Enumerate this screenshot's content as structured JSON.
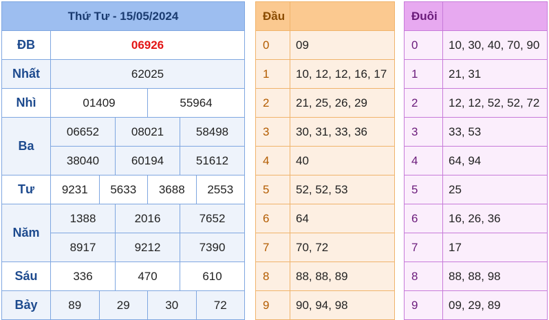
{
  "results": {
    "title": "Thứ Tư - 15/05/2024",
    "db": {
      "label": "ĐB",
      "values": [
        "06926"
      ]
    },
    "nhat": {
      "label": "Nhất",
      "values": [
        "62025"
      ]
    },
    "nhi": {
      "label": "Nhì",
      "values": [
        "01409",
        "55964"
      ]
    },
    "ba": {
      "label": "Ba",
      "values": [
        "06652",
        "08021",
        "58498",
        "38040",
        "60194",
        "51612"
      ]
    },
    "tu": {
      "label": "Tư",
      "values": [
        "9231",
        "5633",
        "3688",
        "2553"
      ]
    },
    "nam": {
      "label": "Năm",
      "values": [
        "1388",
        "2016",
        "7652",
        "8917",
        "9212",
        "7390"
      ]
    },
    "sau": {
      "label": "Sáu",
      "values": [
        "336",
        "470",
        "610"
      ]
    },
    "bay": {
      "label": "Bảy",
      "values": [
        "89",
        "29",
        "30",
        "72"
      ]
    },
    "special_color": "#e31414"
  },
  "dau": {
    "header": "Đầu",
    "rows": [
      {
        "digit": "0",
        "values": "09"
      },
      {
        "digit": "1",
        "values": "10, 12, 12, 16, 17"
      },
      {
        "digit": "2",
        "values": "21, 25, 26, 29"
      },
      {
        "digit": "3",
        "values": "30, 31, 33, 36"
      },
      {
        "digit": "4",
        "values": "40"
      },
      {
        "digit": "5",
        "values": "52, 52, 53"
      },
      {
        "digit": "6",
        "values": "64"
      },
      {
        "digit": "7",
        "values": "70, 72"
      },
      {
        "digit": "8",
        "values": "88, 88, 89"
      },
      {
        "digit": "9",
        "values": "90, 94, 98"
      }
    ]
  },
  "duoi": {
    "header": "Đuôi",
    "rows": [
      {
        "digit": "0",
        "values": "10, 30, 40, 70, 90"
      },
      {
        "digit": "1",
        "values": "21, 31"
      },
      {
        "digit": "2",
        "values": "12, 12, 52, 52, 72"
      },
      {
        "digit": "3",
        "values": "33, 53"
      },
      {
        "digit": "4",
        "values": "64, 94"
      },
      {
        "digit": "5",
        "values": "25"
      },
      {
        "digit": "6",
        "values": "16, 26, 36"
      },
      {
        "digit": "7",
        "values": "17"
      },
      {
        "digit": "8",
        "values": "88, 88, 98"
      },
      {
        "digit": "9",
        "values": "09, 29, 89"
      }
    ]
  }
}
